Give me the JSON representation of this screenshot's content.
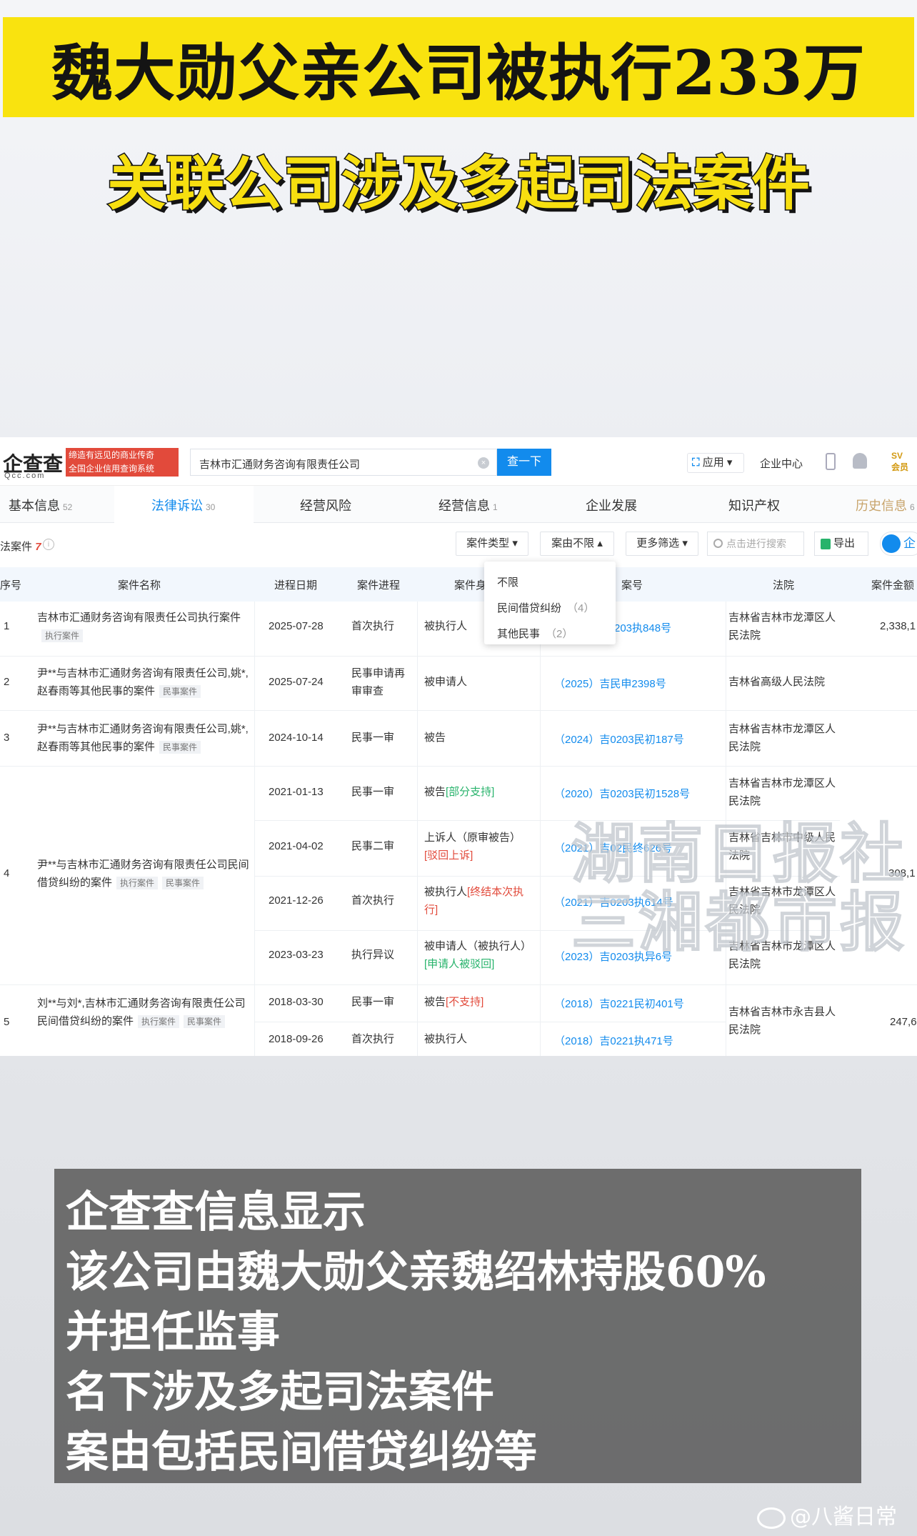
{
  "headline": {
    "line1": "魏大勋父亲公司被执行233万",
    "line2": "关联公司涉及多起司法案件"
  },
  "site": {
    "logo": "企查查",
    "logo_sub": "Qcc.com",
    "slogan_line1": "缔造有远见的商业传奇",
    "slogan_line2": "全国企业信用查询系统",
    "search_value": "吉林市汇通财务咨询有限责任公司",
    "search_button": "查一下",
    "app_button": "应用",
    "enterprise_center": "企业中心",
    "vip_line1": "SV",
    "vip_line2": "会员"
  },
  "tabs": [
    {
      "label": "基本信息",
      "count": "52"
    },
    {
      "label": "法律诉讼",
      "count": "30"
    },
    {
      "label": "经营风险",
      "count": ""
    },
    {
      "label": "经营信息",
      "count": "1"
    },
    {
      "label": "企业发展",
      "count": ""
    },
    {
      "label": "知识产权",
      "count": ""
    },
    {
      "label": "历史信息",
      "count": "6"
    }
  ],
  "filters": {
    "case_count_label": "法案件",
    "case_count": "7",
    "case_type": "案件类型",
    "case_reason": "案由不限",
    "more": "更多筛选",
    "search_placeholder": "点击进行搜索",
    "export": "导出",
    "corner": "企"
  },
  "dropdown": {
    "items": [
      {
        "label": "不限",
        "count": ""
      },
      {
        "label": "民间借贷纠纷",
        "count": "（4）"
      },
      {
        "label": "其他民事",
        "count": "（2）"
      }
    ]
  },
  "table": {
    "headers": [
      "序号",
      "案件名称",
      "进程日期",
      "案件进程",
      "案件身",
      "案号",
      "法院",
      "案件金额"
    ],
    "rows": [
      {
        "no": "1",
        "name": "吉林市汇通财务咨询有限责任公司执行案件",
        "tags": [
          "执行案件"
        ],
        "amount": "2,338,1",
        "entries": [
          {
            "date": "2025-07-28",
            "progress": "首次执行",
            "role": "被执行人",
            "role_extra": "",
            "case_no": "203执848号",
            "court": "吉林省吉林市龙潭区人民法院"
          }
        ]
      },
      {
        "no": "2",
        "name": "尹**与吉林市汇通财务咨询有限责任公司,姚*,赵春雨等其他民事的案件",
        "tags": [
          "民事案件"
        ],
        "amount": "",
        "entries": [
          {
            "date": "2025-07-24",
            "progress": "民事申请再审审查",
            "role": "被申请人",
            "role_extra": "",
            "case_no": "（2025）吉民申2398号",
            "court": "吉林省高级人民法院"
          }
        ]
      },
      {
        "no": "3",
        "name": "尹**与吉林市汇通财务咨询有限责任公司,姚*,赵春雨等其他民事的案件",
        "tags": [
          "民事案件"
        ],
        "amount": "",
        "entries": [
          {
            "date": "2024-10-14",
            "progress": "民事一审",
            "role": "被告",
            "role_extra": "",
            "case_no": "（2024）吉0203民初187号",
            "court": "吉林省吉林市龙潭区人民法院"
          }
        ]
      },
      {
        "no": "4",
        "name": "尹**与吉林市汇通财务咨询有限责任公司民间借贷纠纷的案件",
        "tags": [
          "执行案件",
          "民事案件"
        ],
        "amount": "308,1",
        "entries": [
          {
            "date": "2021-01-13",
            "progress": "民事一审",
            "role": "被告",
            "role_extra": "[部分支持]",
            "case_no": "（2020）吉0203民初1528号",
            "court": "吉林省吉林市龙潭区人民法院"
          },
          {
            "date": "2021-04-02",
            "progress": "民事二审",
            "role": "上诉人（原审被告）",
            "role_extra": "[驳回上诉]",
            "case_no": "（2021）吉02民终626号",
            "court": "吉林省吉林市中级人民法院"
          },
          {
            "date": "2021-12-26",
            "progress": "首次执行",
            "role": "被执行人",
            "role_extra": "[终结本次执行]",
            "case_no": "（2021）吉0203执614号",
            "court": "吉林省吉林市龙潭区人民法院"
          },
          {
            "date": "2023-03-23",
            "progress": "执行异议",
            "role": "被申请人（被执行人）",
            "role_extra": "[申请人被驳回]",
            "case_no": "（2023）吉0203执异6号",
            "court": "吉林省吉林市龙潭区人民法院"
          }
        ]
      },
      {
        "no": "5",
        "name": "刘**与刘*,吉林市汇通财务咨询有限责任公司民间借贷纠纷的案件",
        "tags": [
          "执行案件",
          "民事案件"
        ],
        "amount": "247,6",
        "court_merged": "吉林省吉林市永吉县人民法院",
        "entries": [
          {
            "date": "2018-03-30",
            "progress": "民事一审",
            "role": "被告",
            "role_extra": "[不支持]",
            "case_no": "（2018）吉0221民初401号",
            "court": ""
          },
          {
            "date": "2018-09-26",
            "progress": "首次执行",
            "role": "被执行人",
            "role_extra": "",
            "case_no": "（2018）吉0221执471号",
            "court": ""
          }
        ]
      }
    ]
  },
  "watermark": {
    "line1": "湖南日报社",
    "line2": "三湘都市报"
  },
  "caption": {
    "lines": [
      "企查查信息显示",
      "该公司由魏大勋父亲魏绍林持股60%",
      "并担任监事",
      "名下涉及多起司法案件",
      "案由包括民间借贷纠纷等"
    ]
  },
  "credit": "@八酱日常"
}
